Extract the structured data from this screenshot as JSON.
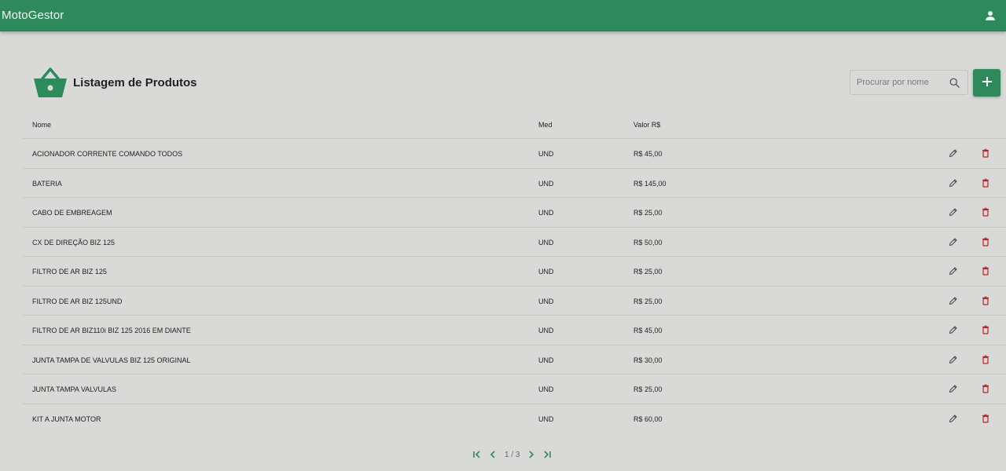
{
  "app": {
    "title": "MotoGestor"
  },
  "page": {
    "title": "Listagem de Produtos"
  },
  "search": {
    "placeholder": "Procurar por nome"
  },
  "table": {
    "headers": {
      "nome": "Nome",
      "med": "Med",
      "valor": "Valor R$"
    },
    "rows": [
      {
        "nome": "ACIONADOR CORRENTE COMANDO TODOS",
        "med": "UND",
        "valor": "R$ 45,00"
      },
      {
        "nome": "BATERIA",
        "med": "UND",
        "valor": "R$ 145,00"
      },
      {
        "nome": "CABO DE EMBREAGEM",
        "med": "UND",
        "valor": "R$ 25,00"
      },
      {
        "nome": "CX DE DIREÇÃO BIZ 125",
        "med": "UND",
        "valor": "R$ 50,00"
      },
      {
        "nome": "FILTRO DE AR BIZ 125",
        "med": "UND",
        "valor": "R$ 25,00"
      },
      {
        "nome": "FILTRO DE AR BIZ 125UND",
        "med": "UND",
        "valor": "R$ 25,00"
      },
      {
        "nome": "FILTRO DE AR BIZ110i BIZ 125 2016 EM DIANTE",
        "med": "UND",
        "valor": "R$ 45,00"
      },
      {
        "nome": "JUNTA TAMPA DE VALVULAS BIZ 125 ORIGINAL",
        "med": "UND",
        "valor": "R$ 30,00"
      },
      {
        "nome": "JUNTA TAMPA VALVULAS",
        "med": "UND",
        "valor": "R$ 25,00"
      },
      {
        "nome": "KIT A JUNTA MOTOR",
        "med": "UND",
        "valor": "R$ 60,00"
      }
    ]
  },
  "pagination": {
    "info": "1 / 3"
  },
  "icons": {
    "user": "user-icon",
    "basket": "basket-icon",
    "search": "search-icon",
    "add": "plus-icon",
    "edit": "pencil-icon",
    "delete": "trash-icon",
    "first": "first-page-icon",
    "prev": "chevron-left-icon",
    "next": "chevron-right-icon",
    "last": "last-page-icon"
  },
  "colors": {
    "primary": "#2e8a5b",
    "delete": "#b3262b",
    "background": "#d9d9d7"
  }
}
